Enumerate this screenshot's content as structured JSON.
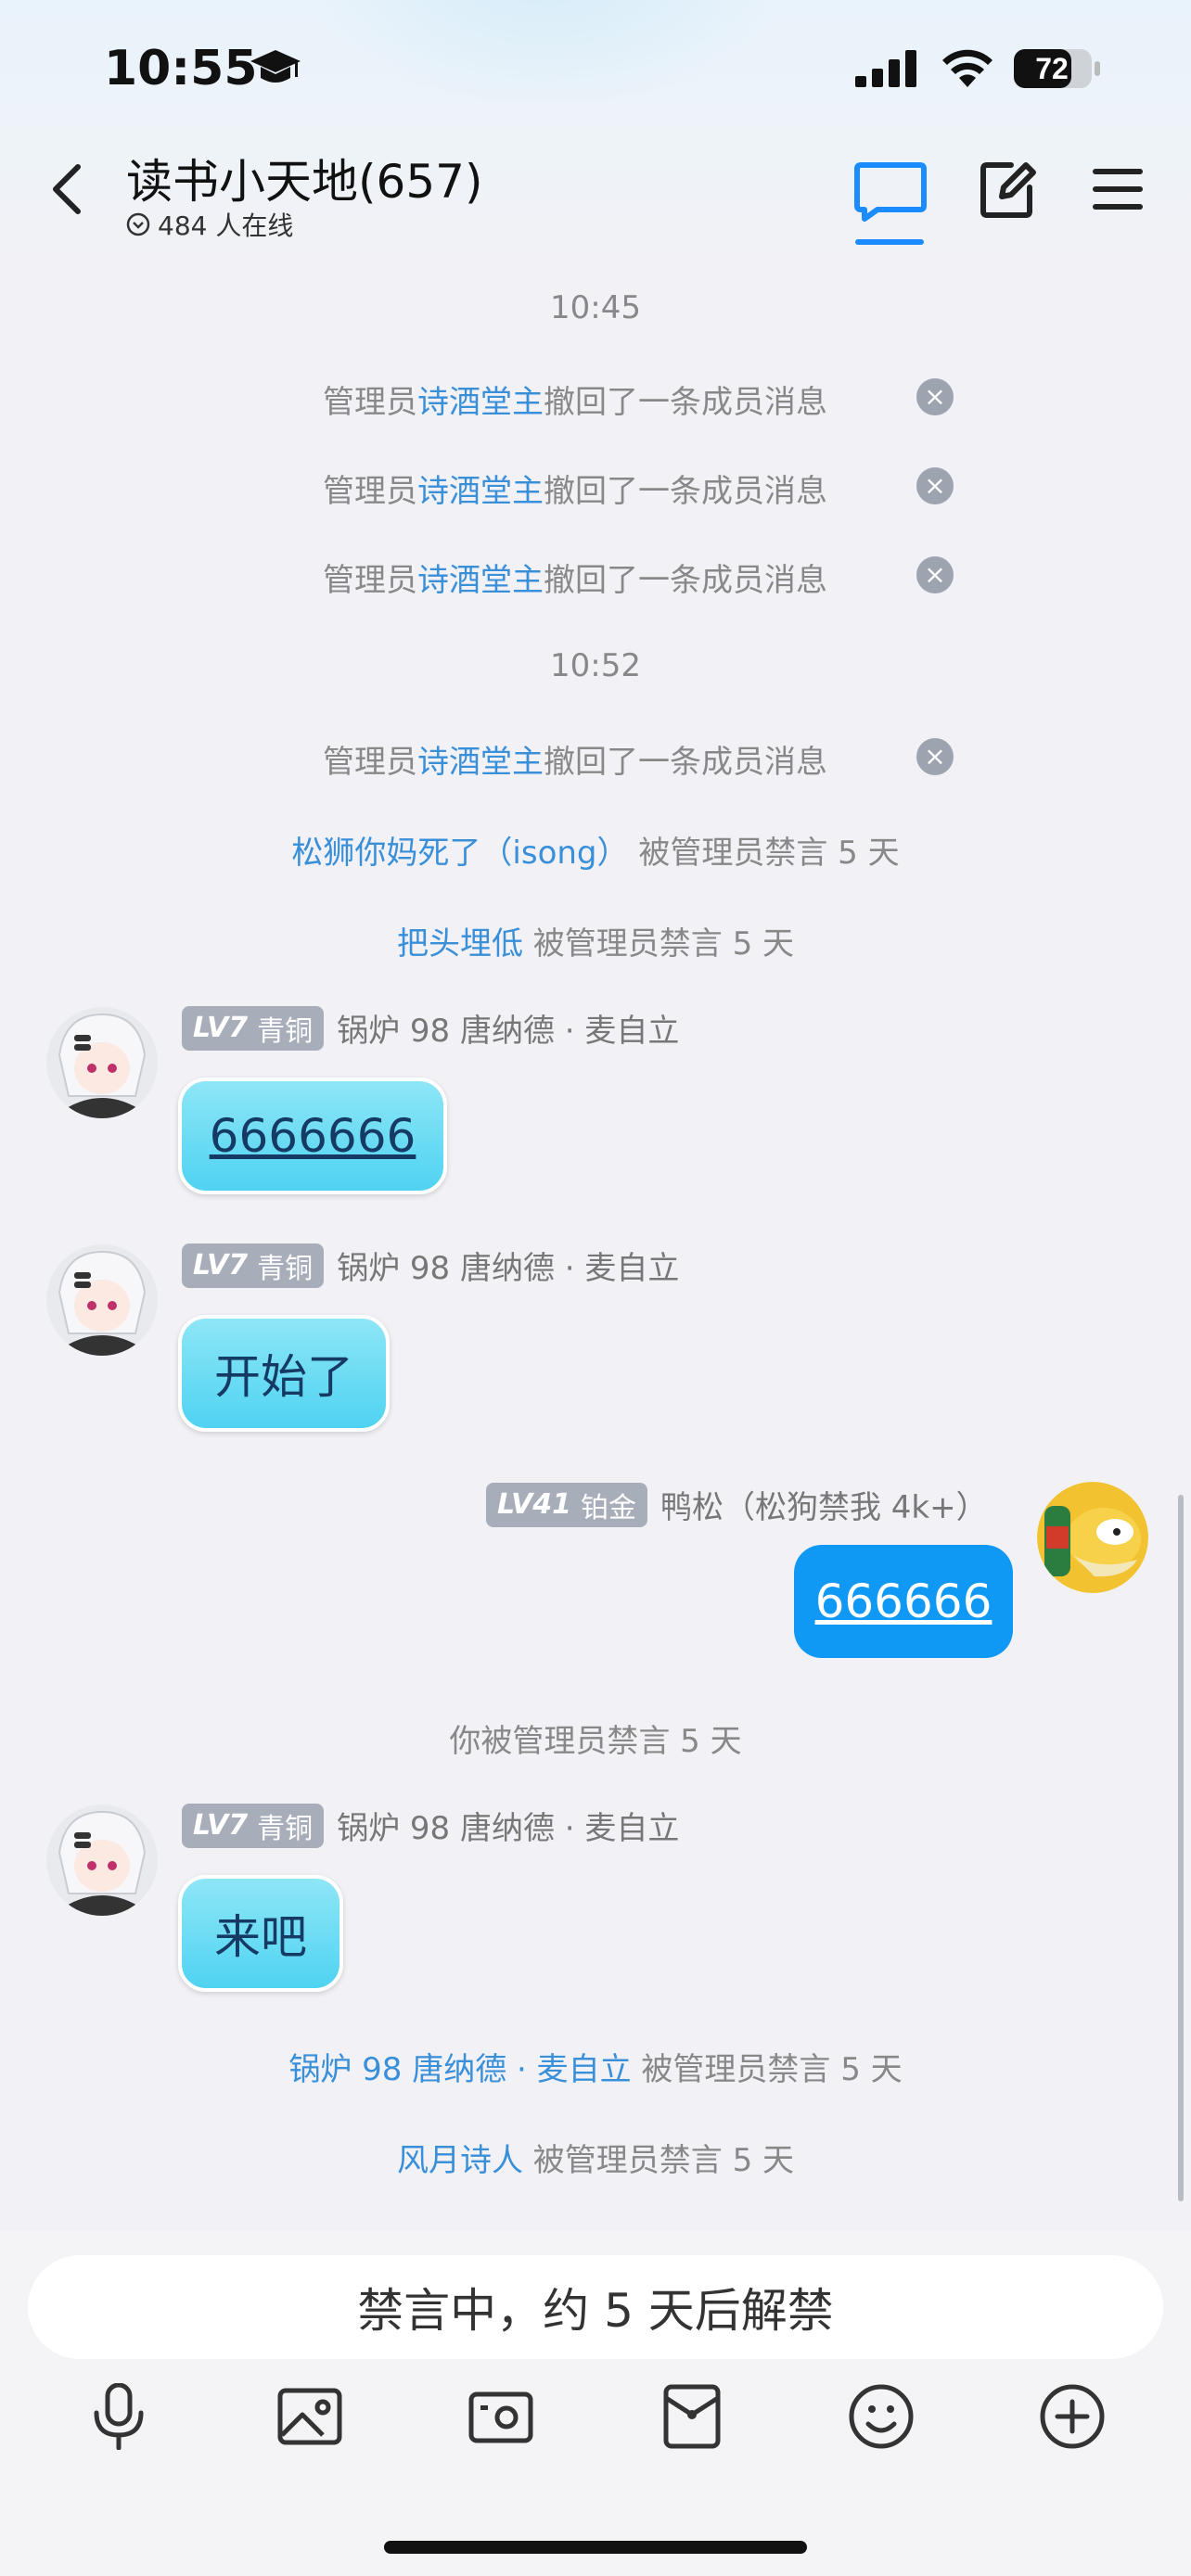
{
  "status_bar": {
    "time": "10:55",
    "battery": "72"
  },
  "header": {
    "title": "读书小天地(657)",
    "online": "484 人在线"
  },
  "messages": {
    "time1": "10:45",
    "recall_prefix": "管理员",
    "recall_admin": "诗酒堂主",
    "recall_suffix": "撤回了一条成员消息",
    "time2": "10:52",
    "ban1_user": "松狮你妈死了（isong）",
    "ban2_user": "把头埋低",
    "ban_suffix": " 被管理员禁言 5 天",
    "user_a": {
      "level": "LV7",
      "rank": "青铜",
      "name": "锅炉 98 唐纳德 · 麦自立"
    },
    "msg1": "6666666",
    "msg2": "开始了",
    "me": {
      "level": "LV41",
      "rank": "铂金",
      "name": "鸭松（松狗禁我 4k+）"
    },
    "msg3": "666666",
    "self_banned": "你被管理员禁言 5 天",
    "msg4": "来吧",
    "ban3_user": "锅炉 98 唐纳德 · 麦自立",
    "ban4_user": "风月诗人"
  },
  "input": {
    "muted_text": "禁言中，约 5 天后解禁"
  },
  "toolbar": {
    "icons": [
      "microphone-icon",
      "image-icon",
      "camera-icon",
      "red-packet-icon",
      "emoji-icon",
      "plus-icon"
    ]
  }
}
